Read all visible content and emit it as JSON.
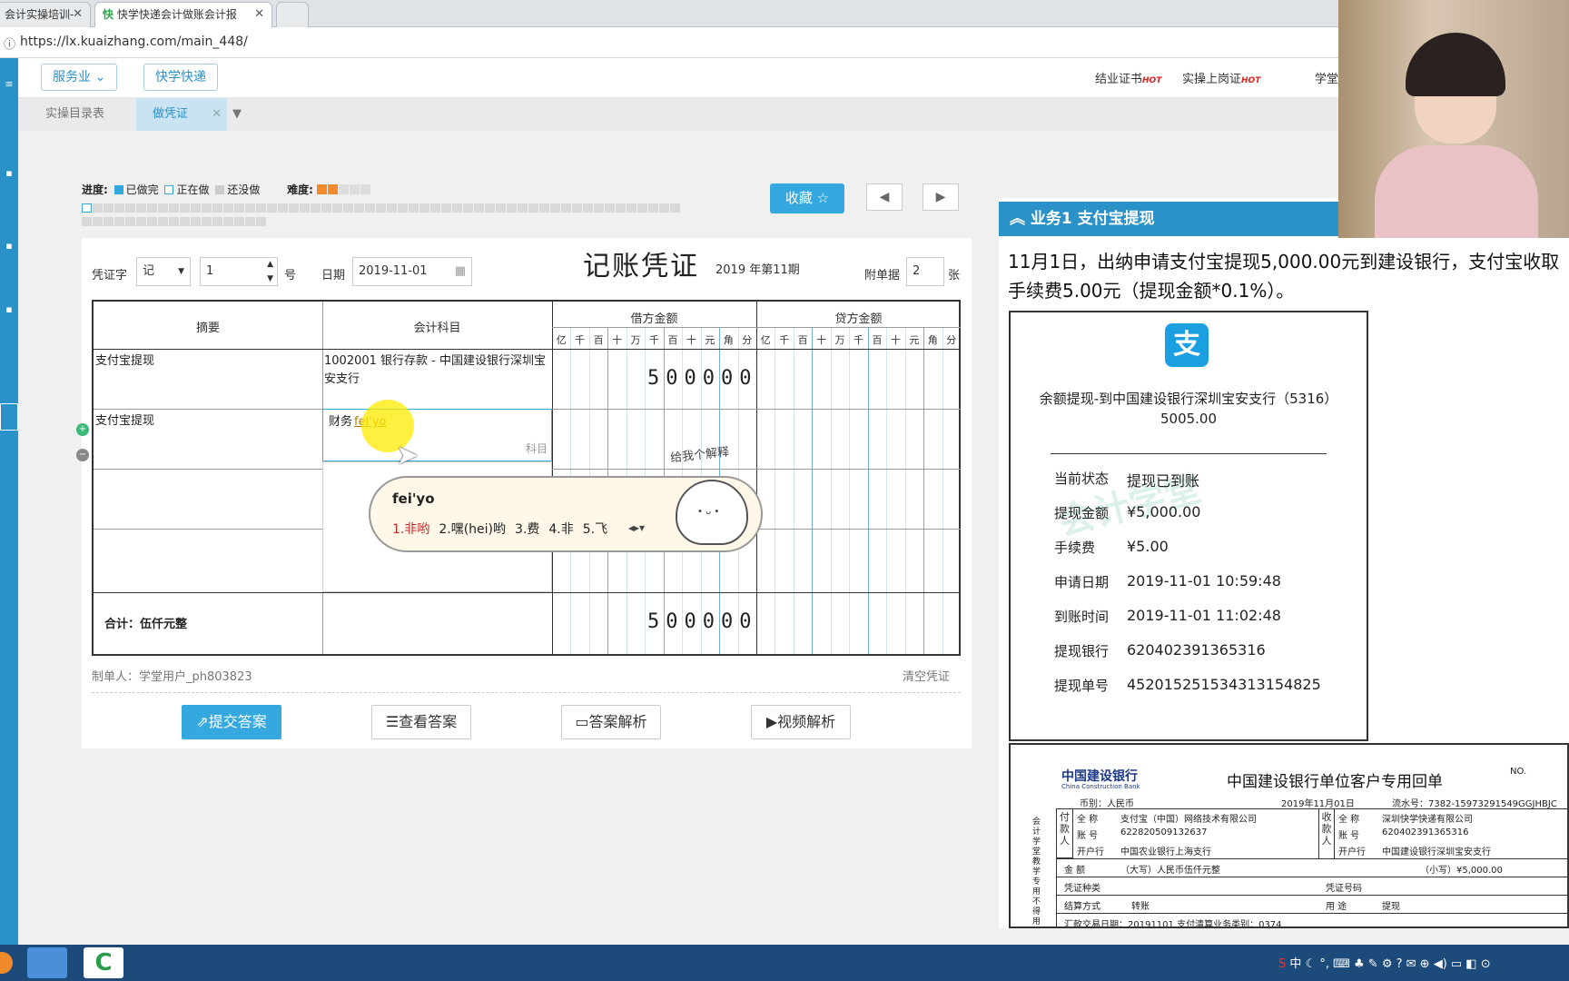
{
  "browser": {
    "tabs": [
      {
        "label": "会计实操培训-"
      },
      {
        "label": "快学快递会计做账会计报"
      }
    ],
    "url": "https://lx.kuaizhang.com/main_448/"
  },
  "header": {
    "industry_btn": "服务业",
    "company_btn": "快学快递",
    "links": [
      "结业证书",
      "实操上岗证",
      "学堂"
    ],
    "hot": "HOT"
  },
  "subtabs": [
    "实操目录表",
    "做凭证"
  ],
  "progress": {
    "label": "进度:",
    "done": "已做完",
    "doing": "正在做",
    "todo": "还没做",
    "difficulty_label": "难度:",
    "difficulty_stars": 2,
    "difficulty_max": 5
  },
  "collect_btn": "收藏",
  "voucher": {
    "word_label": "凭证字",
    "word_value": "记",
    "number_value": "1",
    "number_suffix": "号",
    "date_label": "日期",
    "date_value": "2019-11-01",
    "title": "记账凭证",
    "period": "2019 年第11期",
    "attach_label": "附单据",
    "attach_value": "2",
    "attach_unit": "张",
    "headers": {
      "summary": "摘要",
      "account": "会计科目",
      "debit": "借方金额",
      "credit": "贷方金额",
      "digits": [
        "亿",
        "千",
        "百",
        "十",
        "万",
        "千",
        "百",
        "十",
        "元",
        "角",
        "分"
      ]
    },
    "rows": [
      {
        "summary": "支付宝提现",
        "account": "1002001 银行存款 - 中国建设银行深圳宝安支行",
        "debit": "500000"
      },
      {
        "summary": "支付宝提现",
        "account_input": "财务",
        "account_typing": "fei'yo",
        "account_hint": "科目"
      }
    ],
    "total_label": "合计：伍仟元整",
    "total_debit": "500000",
    "maker": "制单人：学堂用户_ph803823",
    "clear": "清空凭证"
  },
  "ime": {
    "composition": "fei'yo",
    "candidates": [
      "1.非哟",
      "2.嘿(hei)哟",
      "3.费",
      "4.非",
      "5.飞"
    ],
    "mascot_text": "给我个解释"
  },
  "actions": [
    "提交答案",
    "查看答案",
    "答案解析",
    "视频解析"
  ],
  "task": {
    "title": "业务1 支付宝提现",
    "text": "11月1日，出纳申请支付宝提现5,000.00元到建设银行，支付宝收取手续费5.00元（提现金额*0.1%）。"
  },
  "receipt1": {
    "title": "余额提现-到中国建设银行深圳宝安支行（5316）",
    "amount": "5005.00",
    "watermark": "会计学堂",
    "rows": [
      {
        "k": "当前状态",
        "v": "提现已到账"
      },
      {
        "k": "提现金额",
        "v": "¥5,000.00"
      },
      {
        "k": "手续费",
        "v": "¥5.00"
      },
      {
        "k": "申请日期",
        "v": "2019-11-01 10:59:48"
      },
      {
        "k": "到账时间",
        "v": "2019-11-01 11:02:48"
      },
      {
        "k": "提现银行",
        "v": "620402391365316"
      },
      {
        "k": "提现单号",
        "v": "452015251534313154825"
      }
    ]
  },
  "receipt2": {
    "bank": "中国建设银行",
    "bank_en": "China Construction Bank",
    "title": "中国建设银行单位客户专用回单",
    "no": "NO.",
    "currency": "币别：人民币",
    "date": "2019年11月01日",
    "serial": "流水号：7382-15973291549GGJHBJC",
    "payer_label": "付款人",
    "payee_label": "收款人",
    "fullname_label": "全 称",
    "account_label": "账 号",
    "bank_label": "开户行",
    "payer_name": "支付宝（中国）网络技术有限公司",
    "payer_account": "622820509132637",
    "payer_bank": "中国农业银行上海支行",
    "payee_name": "深圳快学快递有限公司",
    "payee_account": "620402391365316",
    "payee_bank": "中国建设银行深圳宝安支行",
    "amount_label": "金 额",
    "amount_big": "（大写）人民币伍仟元整",
    "amount_small": "（小写）¥5,000.00",
    "voucher_type": "凭证种类",
    "voucher_no": "凭证号码",
    "settle": "结算方式",
    "settle_value": "转账",
    "purpose": "用 途",
    "purpose_value": "提现",
    "side_text": "会计学堂教学专用 不得用",
    "footer": "汇款交易日期：20191101 支付清算业务类别：0374"
  },
  "taskbar": {
    "tray": "中"
  }
}
